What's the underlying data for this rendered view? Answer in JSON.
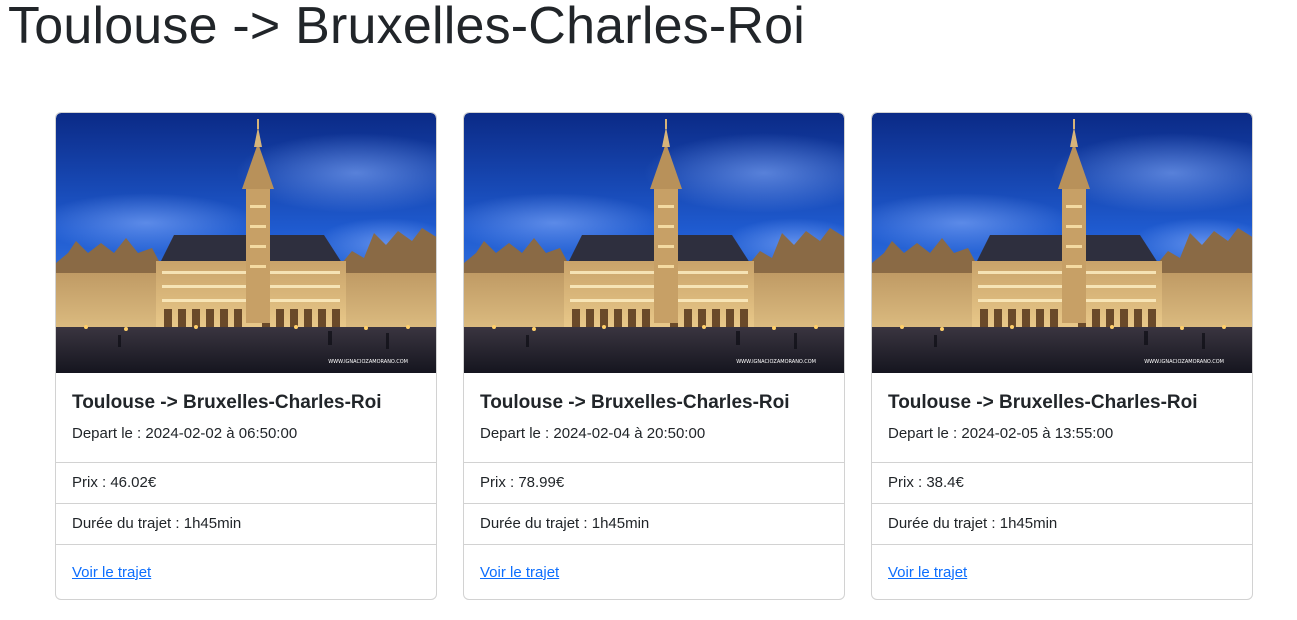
{
  "page": {
    "title": "Toulouse -> Bruxelles-Charles-Roi"
  },
  "image": {
    "watermark": "WWW.IGNACIOZAMORANO.COM"
  },
  "trips": [
    {
      "title": "Toulouse -> Bruxelles-Charles-Roi",
      "departure": "Depart le : 2024-02-02 à 06:50:00",
      "price": "Prix : 46.02€",
      "duration": "Durée du trajet : 1h45min",
      "link": "Voir le trajet"
    },
    {
      "title": "Toulouse -> Bruxelles-Charles-Roi",
      "departure": "Depart le : 2024-02-04 à 20:50:00",
      "price": "Prix : 78.99€",
      "duration": "Durée du trajet : 1h45min",
      "link": "Voir le trajet"
    },
    {
      "title": "Toulouse -> Bruxelles-Charles-Roi",
      "departure": "Depart le : 2024-02-05 à 13:55:00",
      "price": "Prix : 38.4€",
      "duration": "Durée du trajet : 1h45min",
      "link": "Voir le trajet"
    }
  ],
  "colors": {
    "link": "#0d6efd",
    "text": "#212529",
    "border": "#dfdfdf"
  }
}
